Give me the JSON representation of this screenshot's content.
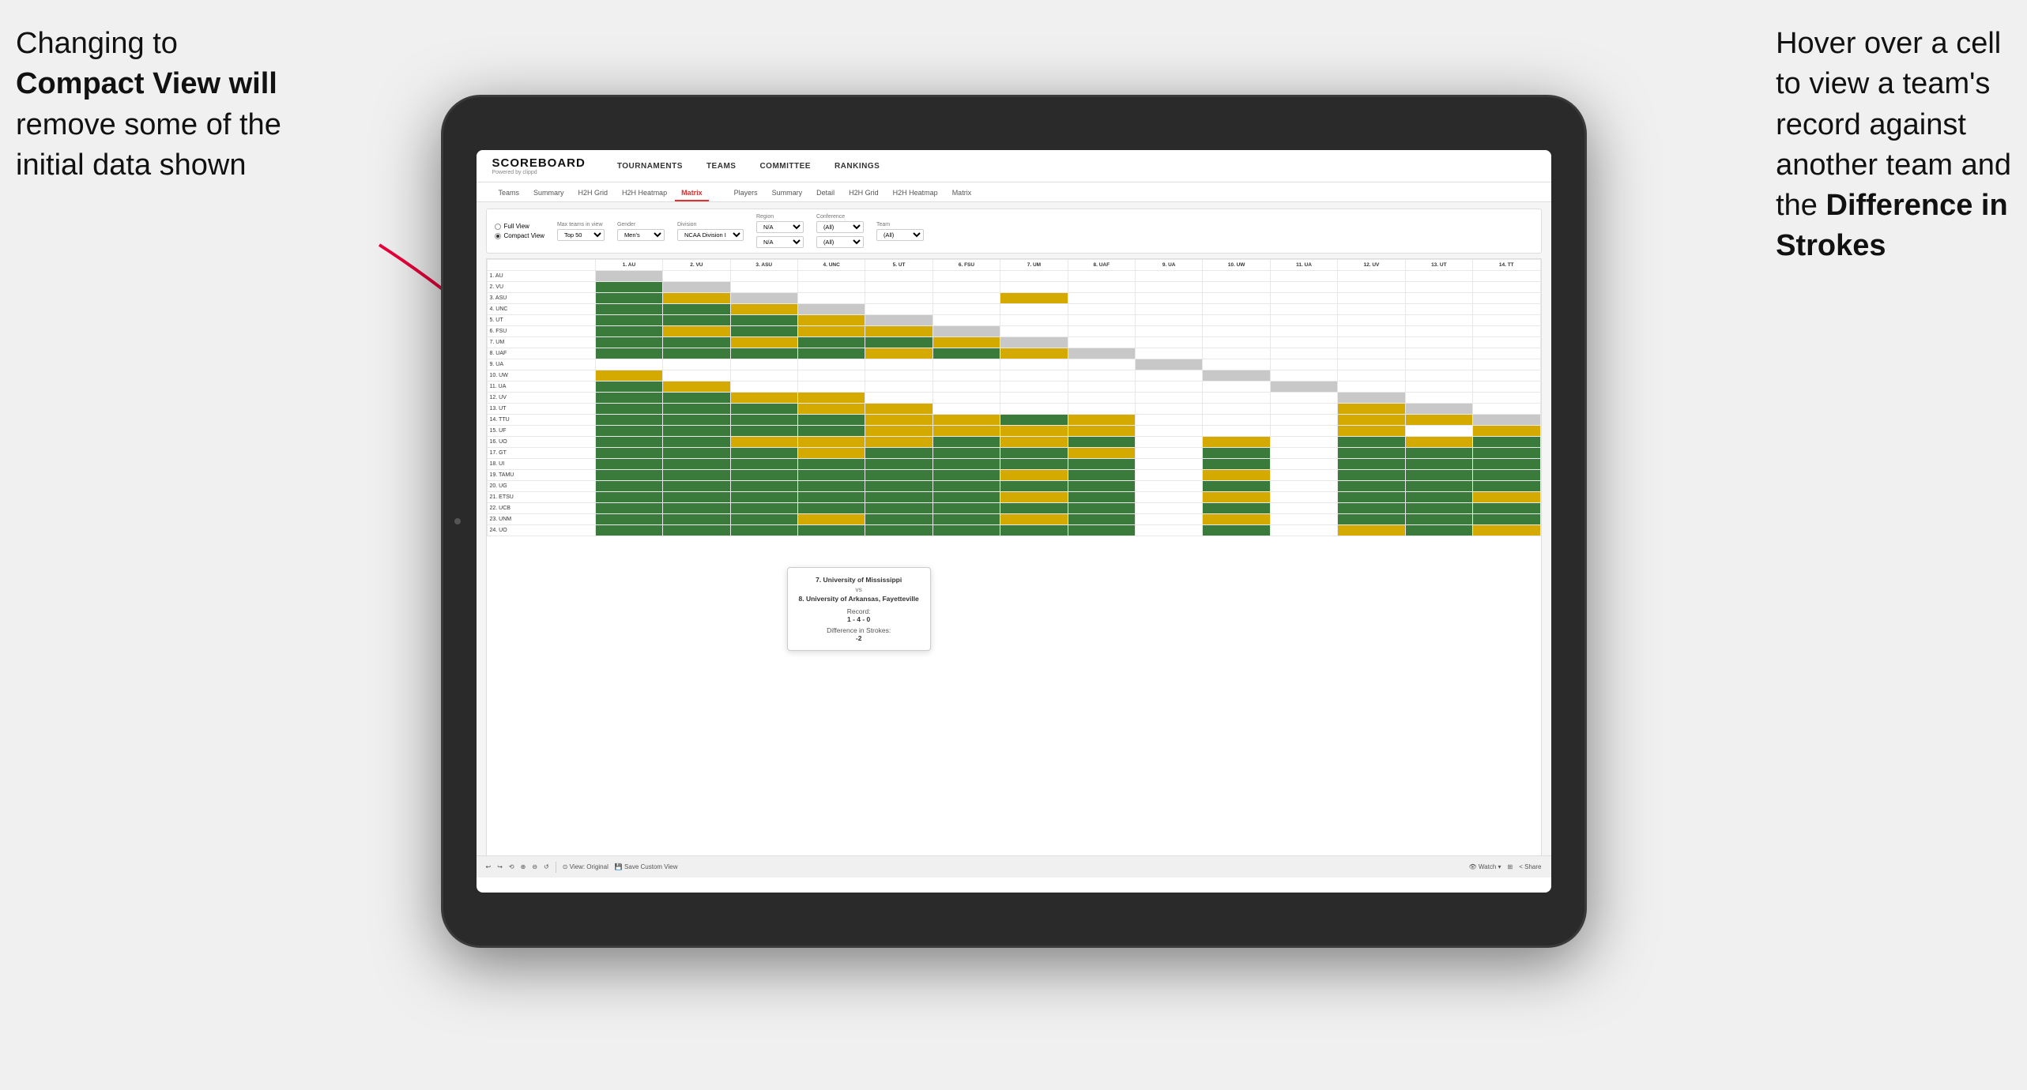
{
  "annotations": {
    "left": {
      "line1": "Changing to",
      "line2": "Compact View will",
      "line3": "remove some of the",
      "line4": "initial data shown"
    },
    "right": {
      "line1": "Hover over a cell",
      "line2": "to view a team's",
      "line3": "record against",
      "line4": "another team and",
      "line5": "the ",
      "line6": "Difference in",
      "line7": "Strokes"
    }
  },
  "nav": {
    "logo": "SCOREBOARD",
    "logo_sub": "Powered by clippd",
    "items": [
      "TOURNAMENTS",
      "TEAMS",
      "COMMITTEE",
      "RANKINGS"
    ]
  },
  "sub_tabs": {
    "teams_section": [
      "Teams",
      "Summary",
      "H2H Grid",
      "H2H Heatmap",
      "Matrix"
    ],
    "players_section": [
      "Players",
      "Summary",
      "Detail",
      "H2H Grid",
      "H2H Heatmap",
      "Matrix"
    ],
    "active": "Matrix"
  },
  "filters": {
    "view_options": [
      "Full View",
      "Compact View"
    ],
    "selected_view": "Compact View",
    "max_teams_label": "Max teams in view",
    "max_teams_value": "Top 50",
    "gender_label": "Gender",
    "gender_value": "Men's",
    "division_label": "Division",
    "division_value": "NCAA Division I",
    "region_label": "Region",
    "region_value": "N/A",
    "conference_label": "Conference",
    "conference_values": [
      "(All)",
      "(All)"
    ],
    "team_label": "Team",
    "team_value": "(All)"
  },
  "matrix": {
    "col_headers": [
      "1. AU",
      "2. VU",
      "3. ASU",
      "4. UNC",
      "5. UT",
      "6. FSU",
      "7. UM",
      "8. UAF",
      "9. UA",
      "10. UW",
      "11. UA",
      "12. UV",
      "13. UT",
      "14. TT"
    ],
    "rows": [
      {
        "label": "1. AU",
        "cells": [
          "gray",
          "white",
          "white",
          "white",
          "white",
          "white",
          "white",
          "white",
          "white",
          "white",
          "white",
          "white",
          "white",
          "white"
        ]
      },
      {
        "label": "2. VU",
        "cells": [
          "green",
          "gray",
          "white",
          "white",
          "white",
          "white",
          "white",
          "white",
          "white",
          "white",
          "white",
          "white",
          "white",
          "white"
        ]
      },
      {
        "label": "3. ASU",
        "cells": [
          "green",
          "yellow",
          "gray",
          "white",
          "white",
          "white",
          "yellow",
          "white",
          "white",
          "white",
          "white",
          "white",
          "white",
          "white"
        ]
      },
      {
        "label": "4. UNC",
        "cells": [
          "green",
          "green",
          "yellow",
          "gray",
          "white",
          "white",
          "white",
          "white",
          "white",
          "white",
          "white",
          "white",
          "white",
          "white"
        ]
      },
      {
        "label": "5. UT",
        "cells": [
          "green",
          "green",
          "green",
          "yellow",
          "gray",
          "white",
          "white",
          "white",
          "white",
          "white",
          "white",
          "white",
          "white",
          "white"
        ]
      },
      {
        "label": "6. FSU",
        "cells": [
          "green",
          "yellow",
          "green",
          "yellow",
          "yellow",
          "gray",
          "white",
          "white",
          "white",
          "white",
          "white",
          "white",
          "white",
          "white"
        ]
      },
      {
        "label": "7. UM",
        "cells": [
          "green",
          "green",
          "yellow",
          "green",
          "green",
          "yellow",
          "gray",
          "white",
          "white",
          "white",
          "white",
          "white",
          "white",
          "white"
        ]
      },
      {
        "label": "8. UAF",
        "cells": [
          "green",
          "green",
          "green",
          "green",
          "yellow",
          "green",
          "yellow",
          "gray",
          "white",
          "white",
          "white",
          "white",
          "white",
          "white"
        ]
      },
      {
        "label": "9. UA",
        "cells": [
          "white",
          "white",
          "white",
          "white",
          "white",
          "white",
          "white",
          "white",
          "gray",
          "white",
          "white",
          "white",
          "white",
          "white"
        ]
      },
      {
        "label": "10. UW",
        "cells": [
          "yellow",
          "white",
          "white",
          "white",
          "white",
          "white",
          "white",
          "white",
          "white",
          "gray",
          "white",
          "white",
          "white",
          "white"
        ]
      },
      {
        "label": "11. UA",
        "cells": [
          "green",
          "yellow",
          "white",
          "white",
          "white",
          "white",
          "white",
          "white",
          "white",
          "white",
          "gray",
          "white",
          "white",
          "white"
        ]
      },
      {
        "label": "12. UV",
        "cells": [
          "green",
          "green",
          "yellow",
          "yellow",
          "white",
          "white",
          "white",
          "white",
          "white",
          "white",
          "white",
          "gray",
          "white",
          "white"
        ]
      },
      {
        "label": "13. UT",
        "cells": [
          "green",
          "green",
          "green",
          "yellow",
          "yellow",
          "white",
          "white",
          "white",
          "white",
          "white",
          "white",
          "yellow",
          "gray",
          "white"
        ]
      },
      {
        "label": "14. TTU",
        "cells": [
          "green",
          "green",
          "green",
          "green",
          "yellow",
          "yellow",
          "green",
          "yellow",
          "white",
          "white",
          "white",
          "yellow",
          "yellow",
          "gray"
        ]
      },
      {
        "label": "15. UF",
        "cells": [
          "green",
          "green",
          "green",
          "green",
          "yellow",
          "yellow",
          "yellow",
          "yellow",
          "white",
          "white",
          "white",
          "yellow",
          "white",
          "yellow"
        ]
      },
      {
        "label": "16. UO",
        "cells": [
          "green",
          "green",
          "yellow",
          "yellow",
          "yellow",
          "green",
          "yellow",
          "green",
          "white",
          "yellow",
          "white",
          "green",
          "yellow",
          "green"
        ]
      },
      {
        "label": "17. GT",
        "cells": [
          "green",
          "green",
          "green",
          "yellow",
          "green",
          "green",
          "green",
          "yellow",
          "white",
          "green",
          "white",
          "green",
          "green",
          "green"
        ]
      },
      {
        "label": "18. UI",
        "cells": [
          "green",
          "green",
          "green",
          "green",
          "green",
          "green",
          "green",
          "green",
          "white",
          "green",
          "white",
          "green",
          "green",
          "green"
        ]
      },
      {
        "label": "19. TAMU",
        "cells": [
          "green",
          "green",
          "green",
          "green",
          "green",
          "green",
          "yellow",
          "green",
          "white",
          "yellow",
          "white",
          "green",
          "green",
          "green"
        ]
      },
      {
        "label": "20. UG",
        "cells": [
          "green",
          "green",
          "green",
          "green",
          "green",
          "green",
          "green",
          "green",
          "white",
          "green",
          "white",
          "green",
          "green",
          "green"
        ]
      },
      {
        "label": "21. ETSU",
        "cells": [
          "green",
          "green",
          "green",
          "green",
          "green",
          "green",
          "yellow",
          "green",
          "white",
          "yellow",
          "white",
          "green",
          "green",
          "yellow"
        ]
      },
      {
        "label": "22. UCB",
        "cells": [
          "green",
          "green",
          "green",
          "green",
          "green",
          "green",
          "green",
          "green",
          "white",
          "green",
          "white",
          "green",
          "green",
          "green"
        ]
      },
      {
        "label": "23. UNM",
        "cells": [
          "green",
          "green",
          "green",
          "yellow",
          "green",
          "green",
          "yellow",
          "green",
          "white",
          "yellow",
          "white",
          "green",
          "green",
          "green"
        ]
      },
      {
        "label": "24. UO",
        "cells": [
          "green",
          "green",
          "green",
          "green",
          "green",
          "green",
          "green",
          "green",
          "white",
          "green",
          "white",
          "yellow",
          "green",
          "yellow"
        ]
      }
    ]
  },
  "tooltip": {
    "team1": "7. University of Mississippi",
    "vs": "vs",
    "team2": "8. University of Arkansas, Fayetteville",
    "record_label": "Record:",
    "record_value": "1 - 4 - 0",
    "diff_label": "Difference in Strokes:",
    "diff_value": "-2"
  },
  "toolbar": {
    "undo": "↩",
    "redo": "↪",
    "view_original": "⊙ View: Original",
    "save_custom": "💾 Save Custom View",
    "watch": "👁 Watch ▾",
    "share": "< Share"
  }
}
